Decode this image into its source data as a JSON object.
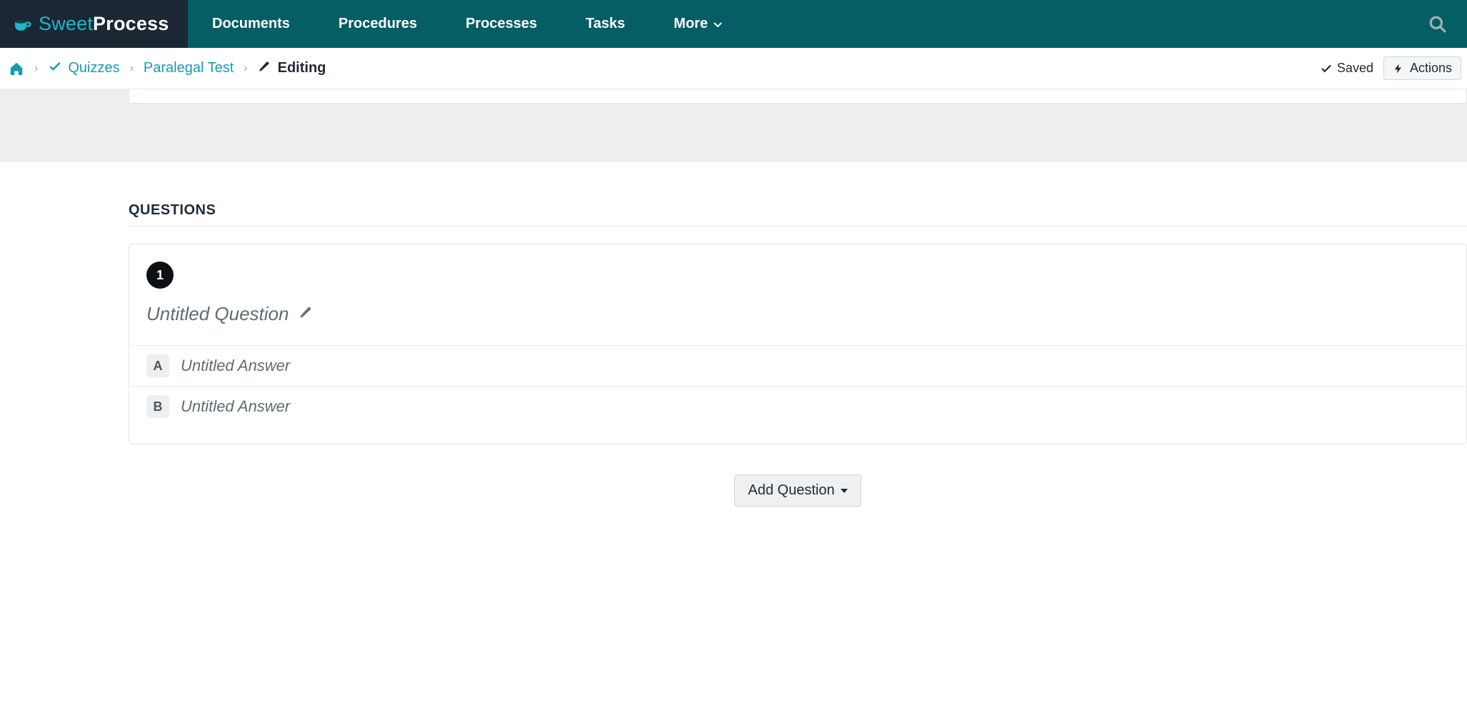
{
  "brand": {
    "left": "Sweet",
    "right": "Process"
  },
  "nav": {
    "items": [
      "Documents",
      "Procedures",
      "Processes",
      "Tasks"
    ],
    "more": "More"
  },
  "breadcrumb": {
    "quizzes": "Quizzes",
    "test_name": "Paralegal Test",
    "editing": "Editing"
  },
  "status": {
    "saved": "Saved"
  },
  "actions_button": "Actions",
  "questions": {
    "heading": "QUESTIONS",
    "items": [
      {
        "number": "1",
        "title": "Untitled Question",
        "answers": [
          {
            "letter": "A",
            "text": "Untitled Answer"
          },
          {
            "letter": "B",
            "text": "Untitled Answer"
          }
        ]
      }
    ]
  },
  "add_question": "Add Question"
}
